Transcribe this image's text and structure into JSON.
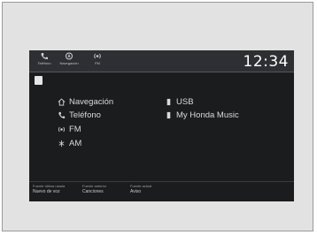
{
  "topbar": {
    "items": [
      {
        "label": "Teléfono",
        "icon": "phone-icon"
      },
      {
        "label": "Navegación",
        "icon": "navigation-icon"
      },
      {
        "label": "FM",
        "icon": "radio-icon"
      }
    ]
  },
  "clock": "12:34",
  "menu": {
    "left": [
      {
        "label": "Navegación",
        "icon": "home-icon"
      },
      {
        "label": "Teléfono",
        "icon": "phone-icon"
      },
      {
        "label": "FM",
        "icon": "radio-icon"
      },
      {
        "label": "AM",
        "icon": "radio-am-icon"
      }
    ],
    "right": [
      {
        "label": "USB",
        "icon": "usb-icon"
      },
      {
        "label": "My Honda Music",
        "icon": "music-icon"
      }
    ]
  },
  "bottom": [
    {
      "line1": "Fuente última usada",
      "line2": "Nuevo de voz"
    },
    {
      "line1": "Fuente anterior",
      "line2": "Canciones"
    },
    {
      "line1": "Fuente actual",
      "line2": "Aviso"
    }
  ],
  "colors": {
    "screen_bg": "#1b1c1e",
    "topbar_bg": "#2d2f33",
    "text": "#e9e9e9"
  }
}
